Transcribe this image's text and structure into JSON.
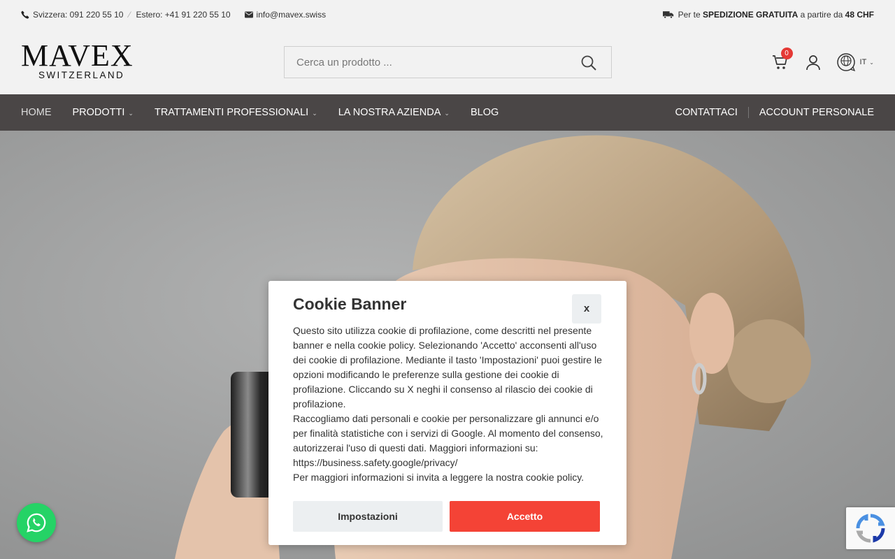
{
  "topbar": {
    "phone_ch": "Svizzera: 091 220 55 10",
    "phone_abroad": "Estero: +41 91 220 55 10",
    "email": "info@mavex.swiss",
    "shipping_prefix": "Per te",
    "shipping_bold": "SPEDIZIONE GRATUITA",
    "shipping_mid": "a partire da",
    "shipping_amount": "48 CHF"
  },
  "logo": {
    "name": "MAVEX",
    "tagline": "SWITZERLAND"
  },
  "search": {
    "placeholder": "Cerca un prodotto ..."
  },
  "cart": {
    "count": "0"
  },
  "language": {
    "current": "IT"
  },
  "nav": {
    "items": [
      {
        "label": "HOME",
        "has_dropdown": false
      },
      {
        "label": "PRODOTTI",
        "has_dropdown": true
      },
      {
        "label": "TRATTAMENTI PROFESSIONALI",
        "has_dropdown": true
      },
      {
        "label": "LA NOSTRA AZIENDA",
        "has_dropdown": true
      },
      {
        "label": "BLOG",
        "has_dropdown": false
      }
    ],
    "contact": "CONTATTACI",
    "account": "ACCOUNT PERSONALE"
  },
  "cookie": {
    "title": "Cookie Banner",
    "close_label": "x",
    "paragraphs": [
      "Questo sito utilizza cookie di profilazione, come descritti nel presente banner e nella cookie policy. Selezionando 'Accetto' acconsenti all'uso dei cookie di profilazione. Mediante il tasto 'Impostazioni' puoi gestire le opzioni modificando le preferenze sulla gestione dei cookie di profilazione. Cliccando su X neghi il consenso al rilascio dei cookie di profilazione.",
      "Raccogliamo dati personali e cookie per personalizzare gli annunci e/o per finalità statistiche con i servizi di Google. Al momento del consenso, autorizzerai l'uso di questi dati. Maggiori informazioni su: https://business.safety.google/privacy/",
      "Per maggiori informazioni si invita a leggere la nostra cookie policy."
    ],
    "settings_label": "Impostazioni",
    "accept_label": "Accetto"
  },
  "colors": {
    "nav_bg": "#4a4646",
    "accent_red": "#f44336",
    "whatsapp_green": "#25d366"
  }
}
